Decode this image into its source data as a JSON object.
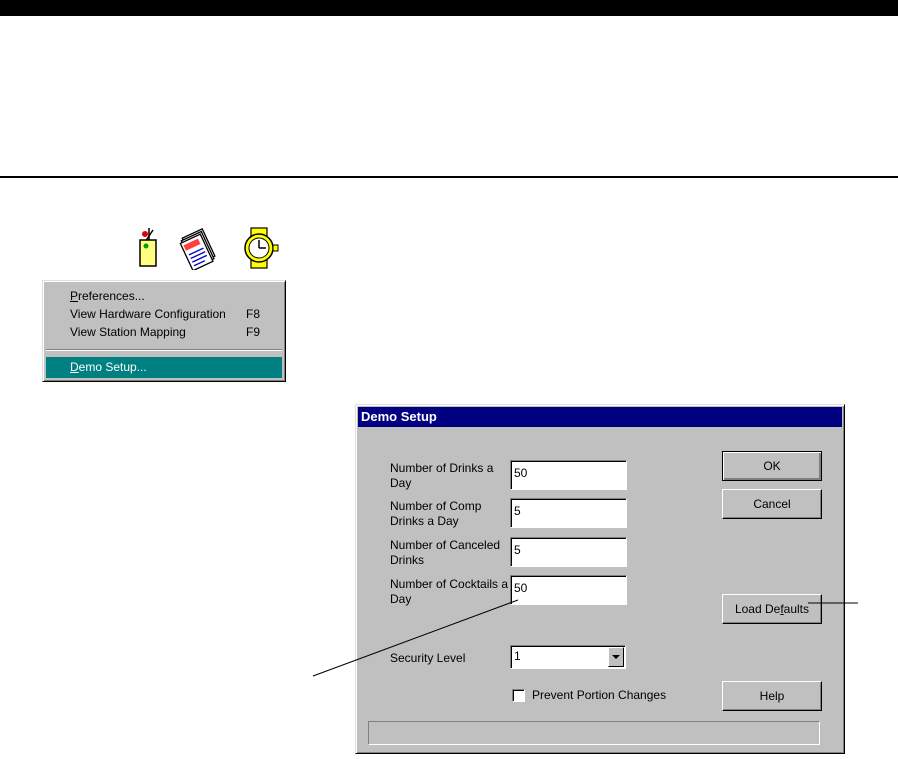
{
  "toolbar": {
    "icons": [
      "drink-icon",
      "menu-report-icon",
      "clock-icon"
    ]
  },
  "menu": {
    "items": [
      {
        "label": "Preferences...",
        "mnemonic": "P",
        "rest": "references..."
      },
      {
        "label": "View Hardware Configuration",
        "shortcut": "F8"
      },
      {
        "label": "View Station Mapping",
        "shortcut": "F9"
      },
      {
        "label": "Demo Setup...",
        "mnemonic": "D",
        "rest": "emo Setup...",
        "highlighted": true
      }
    ]
  },
  "dialog": {
    "title": "Demo Setup",
    "fields": [
      {
        "label": "Number of Drinks a Day",
        "value": "50"
      },
      {
        "label": "Number of Comp Drinks a Day",
        "value": "5"
      },
      {
        "label": "Number of Canceled Drinks",
        "value": "5"
      },
      {
        "label": "Number of Cocktails a Day",
        "value": "50"
      }
    ],
    "security": {
      "label": "Security Level",
      "value": "1"
    },
    "checkbox": {
      "label": "Prevent Portion Changes",
      "checked": false
    },
    "buttons": {
      "ok": "OK",
      "cancel": "Cancel",
      "load_defaults_pre": "Load De",
      "load_defaults_mnemonic": "f",
      "load_defaults_post": "aults",
      "help": "Help"
    },
    "status": ""
  },
  "colors": {
    "title_bar": "#000080",
    "menu_highlight": "#008080",
    "face": "#c0c0c0"
  }
}
